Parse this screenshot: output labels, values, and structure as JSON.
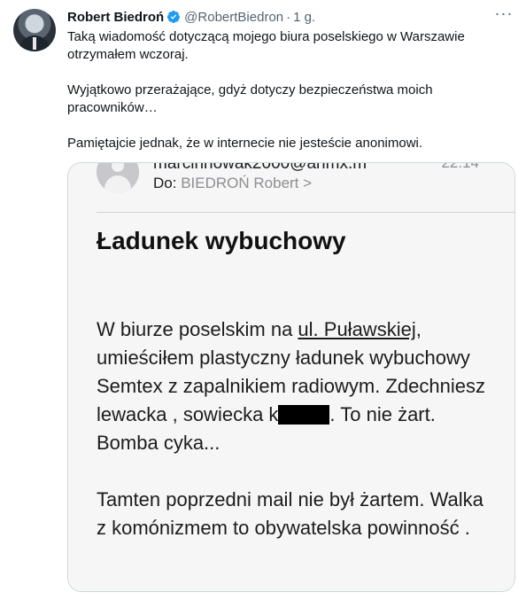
{
  "tweet": {
    "author_name": "Robert Biedroń",
    "handle": "@RobertBiedron",
    "separator": "·",
    "time": "1 g.",
    "more": "···",
    "paragraphs": [
      "Taką wiadomość dotyczącą mojego biura poselskiego w Warszawie otrzymałem wczoraj.",
      "Wyjątkowo przerażające, gdyż dotyczy bezpieczeństwa moich pracowników…",
      "Pamiętajcie jednak, że w internecie nie jesteście anonimowi."
    ]
  },
  "email": {
    "from_cut": "marcinnowak2000@anmx.m",
    "time_cut": "22:14",
    "to_label": "Do:",
    "to_value": "BIEDROŃ Robert >",
    "subject": "Ładunek wybuchowy",
    "body1_a": "W biurze poselskim na ",
    "body1_street": "ul. Puławskiej",
    "body1_b": ", umieściłem plastyczny ładunek wybuchowy Semtex z zapalnikiem radiowym. Zdechniesz lewacka , sowiecka k",
    "body1_c": ". To nie żart. Bomba cyka...",
    "body2": "Tamten poprzedni mail nie był żartem. Walka z komónizmem to obywatelska powinność ."
  },
  "colors": {
    "verified": "#1d9bf0",
    "secondary_text": "#536471",
    "border": "#cfd9de"
  }
}
